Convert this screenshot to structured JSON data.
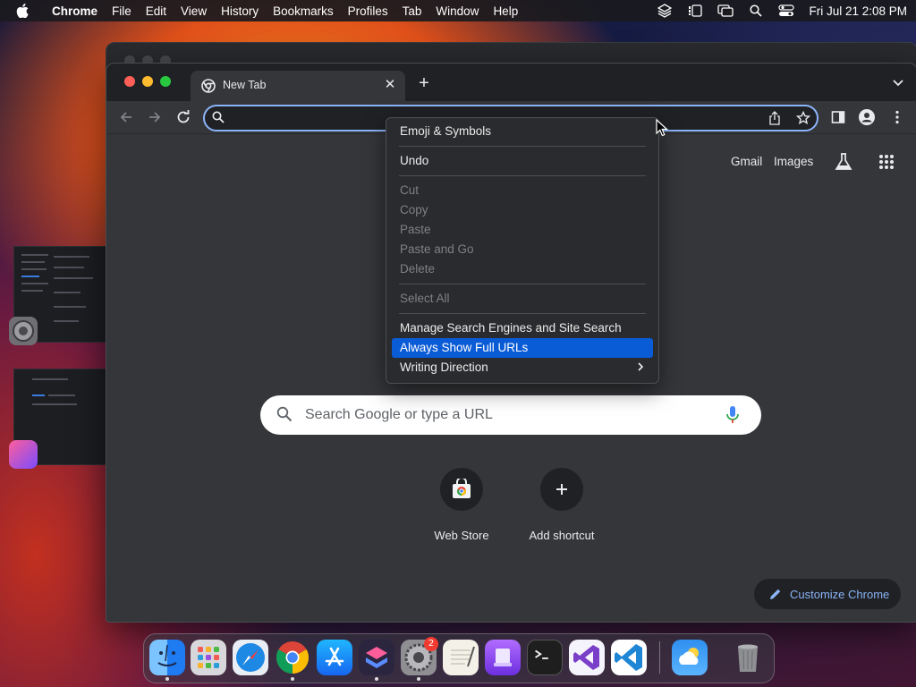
{
  "menubar": {
    "app": "Chrome",
    "items": [
      "File",
      "Edit",
      "View",
      "History",
      "Bookmarks",
      "Profiles",
      "Tab",
      "Window",
      "Help"
    ],
    "clock": "Fri Jul 21  2:08 PM"
  },
  "browser": {
    "tab_title": "New Tab",
    "omnibox_value": ""
  },
  "ntp": {
    "gmail": "Gmail",
    "images": "Images",
    "search_placeholder": "Search Google or type a URL",
    "shortcuts": [
      "Web Store",
      "Add shortcut"
    ],
    "customize": "Customize Chrome"
  },
  "context_menu": {
    "items": [
      {
        "label": "Emoji & Symbols",
        "enabled": true
      },
      {
        "label": "Undo",
        "enabled": true
      },
      {
        "label": "Cut",
        "enabled": false
      },
      {
        "label": "Copy",
        "enabled": false
      },
      {
        "label": "Paste",
        "enabled": false
      },
      {
        "label": "Paste and Go",
        "enabled": false
      },
      {
        "label": "Delete",
        "enabled": false
      },
      {
        "label": "Select All",
        "enabled": false
      },
      {
        "label": "Manage Search Engines and Site Search",
        "enabled": true
      },
      {
        "label": "Always Show Full URLs",
        "enabled": true,
        "highlighted": true
      },
      {
        "label": "Writing Direction",
        "enabled": true,
        "submenu": true
      }
    ]
  },
  "dock": {
    "apps": [
      "finder-icon",
      "launchpad-icon",
      "safari-icon",
      "chrome-icon",
      "app-store-icon",
      "shortcuts-icon",
      "system-settings-icon",
      "textedit-icon",
      "apple-configurator-icon",
      "terminal-icon",
      "visual-studio-icon",
      "vscode-icon",
      "weather-icon",
      "trash-icon"
    ],
    "settings_badge": "2"
  },
  "colors": {
    "accent": "#8ab4f8",
    "menu_highlight": "#0a5bd6",
    "window_bg": "#35363a",
    "tabstrip_bg": "#202124"
  }
}
